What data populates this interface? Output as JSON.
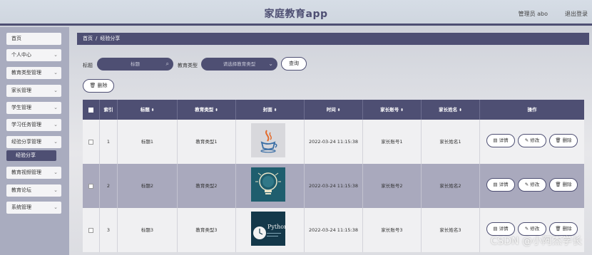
{
  "header": {
    "title": "家庭教育app",
    "user": "管理员 abo",
    "logout": "退出登录"
  },
  "sidebar": {
    "items": [
      {
        "label": "首页",
        "chevron": false
      },
      {
        "label": "个人中心",
        "chevron": true
      },
      {
        "label": "教育类型管理",
        "chevron": true
      },
      {
        "label": "家长管理",
        "chevron": true
      },
      {
        "label": "学生管理",
        "chevron": true
      },
      {
        "label": "学习任务管理",
        "chevron": true
      },
      {
        "label": "经验分享管理",
        "chevron": true
      },
      {
        "label": "教育视频管理",
        "chevron": true
      },
      {
        "label": "教育论坛",
        "chevron": true
      },
      {
        "label": "系统管理",
        "chevron": true
      }
    ],
    "active_sub": "经验分享",
    "chevron_glyph": "⌄"
  },
  "breadcrumb": {
    "home": "首页",
    "sep": "/",
    "current": "经验分享"
  },
  "search": {
    "title_label": "标题",
    "title_placeholder": "标题",
    "type_label": "教育类型",
    "type_placeholder": "请选择教育类型",
    "search_button": "查询",
    "delete_button": "删除"
  },
  "table": {
    "headers": {
      "index": "索引",
      "title": "标题",
      "type": "教育类型",
      "cover": "封面",
      "time": "时间",
      "account": "家长账号",
      "name": "家长姓名",
      "actions": "操作"
    },
    "sort_glyph": "⬍",
    "actions": {
      "detail": "详情",
      "edit": "修改",
      "delete": "删除"
    },
    "rows": [
      {
        "index": "1",
        "title": "标题1",
        "type": "教育类型1",
        "cover": "java",
        "time": "2022-03-24 11:15:38",
        "account": "家长账号1",
        "name": "家长姓名1"
      },
      {
        "index": "2",
        "title": "标题2",
        "type": "教育类型2",
        "cover": "lightbulb",
        "time": "2022-03-24 11:15:38",
        "account": "家长账号2",
        "name": "家长姓名2"
      },
      {
        "index": "3",
        "title": "标题3",
        "type": "教育类型3",
        "cover": "python",
        "time": "2022-03-24 11:15:38",
        "account": "家长账号3",
        "name": "家长姓名3"
      }
    ]
  },
  "covers": {
    "python_text": "Python"
  },
  "watermark": "CSDN @小阿杰学长",
  "colors": {
    "accent": "#4e4f73",
    "sidebar": "#a9acbf",
    "row_alt": "#a9a9bd"
  }
}
